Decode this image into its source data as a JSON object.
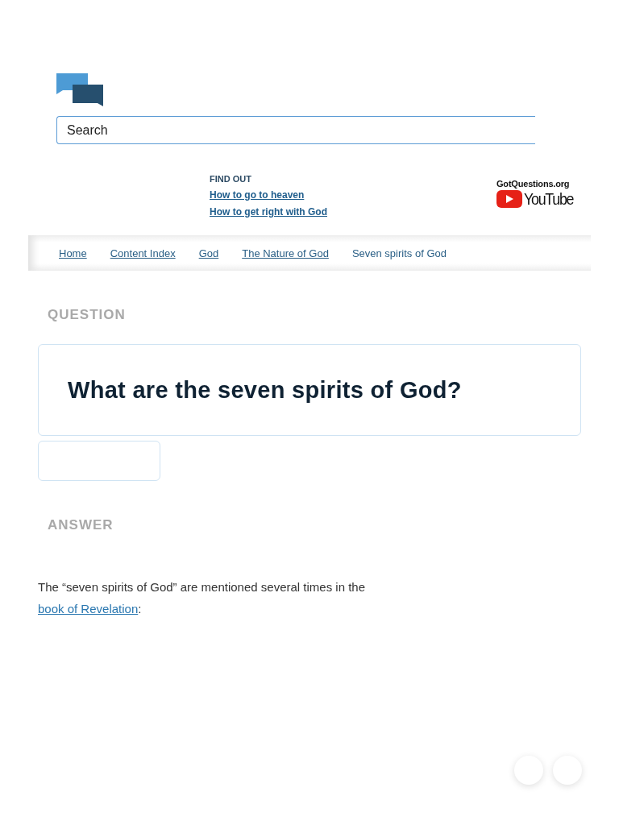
{
  "search": {
    "placeholder": "Search"
  },
  "find_out": {
    "heading": "FIND OUT",
    "links": [
      "How to go to heaven",
      "How to get right with God"
    ]
  },
  "channel_badge": {
    "site": "GotQuestions.org",
    "platform": "YouTube"
  },
  "breadcrumbs": [
    {
      "label": "Home",
      "current": false
    },
    {
      "label": "Content Index",
      "current": false
    },
    {
      "label": "God",
      "current": false
    },
    {
      "label": "The Nature of God",
      "current": false
    },
    {
      "label": "Seven spirits of God",
      "current": true
    }
  ],
  "question": {
    "label": "QUESTION",
    "title": "What are the seven spirits of God?"
  },
  "answer": {
    "label": "ANSWER",
    "text_before": "The “seven spirits of God” are mentioned several times in the ",
    "link": "book of Revelation",
    "text_after": ":"
  }
}
